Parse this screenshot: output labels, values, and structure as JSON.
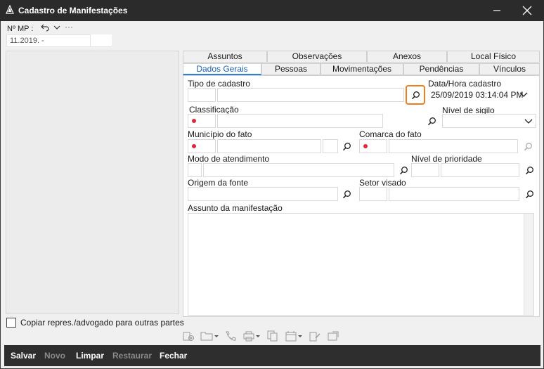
{
  "window": {
    "title": "Cadastro de Manifestações",
    "controls": [
      "minimize-icon",
      "close-icon"
    ]
  },
  "mp": {
    "label": "Nº MP :",
    "value": "11.2019.        -",
    "tools": [
      "undo-icon",
      "chevron-down-icon",
      "more-icon"
    ]
  },
  "left": {
    "copy_label": "Copiar repres./advogado para outras partes"
  },
  "tabs": {
    "row1": [
      {
        "label": "Assuntos"
      },
      {
        "label": "Observações"
      },
      {
        "label": "Anexos"
      },
      {
        "label": "Local Físico"
      }
    ],
    "row2": [
      {
        "label": "Dados Gerais",
        "active": true
      },
      {
        "label": "Pessoas"
      },
      {
        "label": "Movimentações"
      },
      {
        "label": "Pendências"
      },
      {
        "label": "Vínculos"
      }
    ]
  },
  "form": {
    "tipo_cadastro": "Tipo de cadastro",
    "data_hora_label": "Data/Hora cadastro",
    "data_hora_value": "25/09/2019 03:14:04 PM",
    "classificacao": "Classificação",
    "nivel_sigilo": "Nível de sigilo",
    "municipio": "Município do fato",
    "comarca": "Comarca do fato",
    "modo_atendimento": "Modo de atendimento",
    "nivel_prioridade": "Nível de prioridade",
    "origem_fonte": "Origem da fonte",
    "setor_visado": "Setor visado",
    "assunto": "Assunto da manifestação"
  },
  "toolbar_icons": [
    "add-person-icon",
    "folder-icon",
    "phone-icon",
    "print-icon",
    "copy-icon",
    "calendar-icon",
    "edit-doc-icon",
    "move-doc-icon"
  ],
  "bottom": {
    "salvar": "Salvar",
    "novo": "Novo",
    "limpar": "Limpar",
    "restaurar": "Restaurar",
    "fechar": "Fechar"
  },
  "colors": {
    "accent": "#2f7fd1",
    "required": "#e0283a",
    "focus": "#f07d1a",
    "titlebar": "#2b2b2b"
  }
}
